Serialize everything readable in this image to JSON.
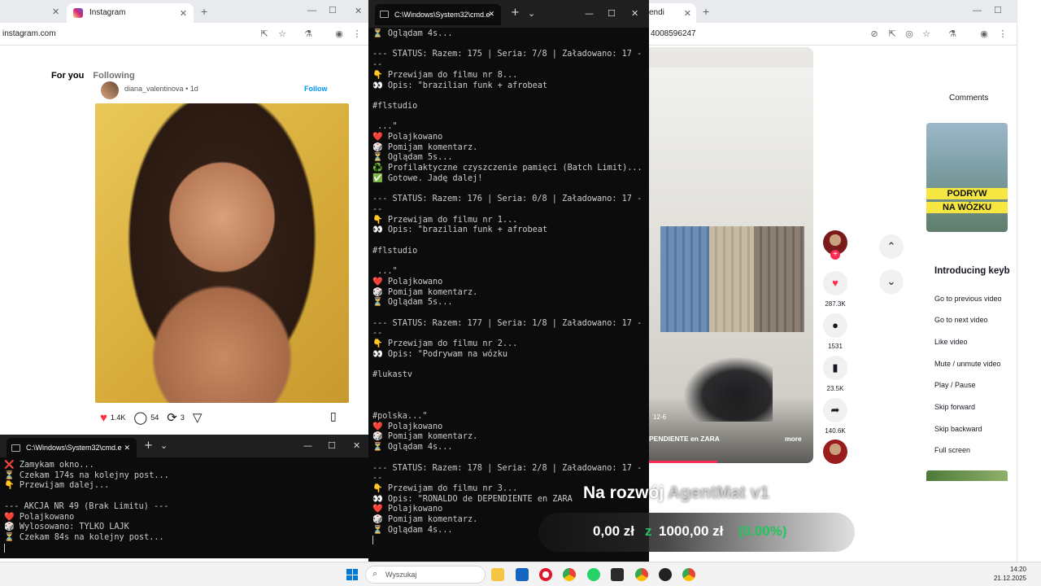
{
  "left_browser": {
    "tab_title": "Instagram",
    "url": "instagram.com",
    "feed_tabs": [
      "For you",
      "Following"
    ],
    "post": {
      "username": "diana_valentinova",
      "time": "1d",
      "follow_label": "Follow",
      "likes": "1.4K",
      "comments": "54",
      "reposts": "3"
    }
  },
  "terminal_main": {
    "title": "C:\\Windows\\System32\\cmd.e",
    "lines": [
      "⏳ Oglądam 4s...",
      "",
      "--- STATUS: Razem: 175 | Seria: 7/8 | Załadowano: 17 -",
      "--",
      "👇 Przewijam do filmu nr 8...",
      "👀 Opis: \"brazilian funk + afrobeat",
      "",
      "#flstudio",
      "",
      " ...\"",
      "❤️ Polajkowano",
      "🎲 Pomijam komentarz.",
      "⏳ Oglądam 5s...",
      "♻️ Profilaktyczne czyszczenie pamięci (Batch Limit)...",
      "✅ Gotowe. Jadę dalej!",
      "",
      "--- STATUS: Razem: 176 | Seria: 0/8 | Załadowano: 17 -",
      "--",
      "👇 Przewijam do filmu nr 1...",
      "👀 Opis: \"brazilian funk + afrobeat",
      "",
      "#flstudio",
      "",
      " ...\"",
      "❤️ Polajkowano",
      "🎲 Pomijam komentarz.",
      "⏳ Oglądam 5s...",
      "",
      "--- STATUS: Razem: 177 | Seria: 1/8 | Załadowano: 17 -",
      "--",
      "👇 Przewijam do filmu nr 2...",
      "👀 Opis: \"Podrywam na wózku",
      "",
      "#lukastv",
      "",
      "",
      "",
      "#polska...\"",
      "❤️ Polajkowano",
      "🎲 Pomijam komentarz.",
      "⏳ Oglądam 4s...",
      "",
      "--- STATUS: Razem: 178 | Seria: 2/8 | Załadowano: 17 -",
      "--",
      "👇 Przewijam do filmu nr 3...",
      "👀 Opis: \"RONALDO de DEPENDIENTE en ZARA",
      "❤️ Polajkowano",
      "🎲 Pomijam komentarz.",
      "⏳ Oglądam 4s..."
    ]
  },
  "terminal_small": {
    "title": "C:\\Windows\\System32\\cmd.e",
    "lines": [
      "❌ Zamykam okno...",
      "⏳ Czekam 174s na kolejny post...",
      "👇 Przewijam dalej...",
      "",
      "--- AKCJA NR 49 (Brak Limitu) ---",
      "❤️ Polajkowano",
      "🎲 Wylosowano: TYLKO LAJK",
      "⏳ Czekam 84s na kolejny post..."
    ]
  },
  "right_browser": {
    "tab_title": "endi",
    "url_fragment": "4008596247",
    "video": {
      "caption": "PENDIENTE en ZARA",
      "more_label": "more",
      "timestamp": "12-6"
    },
    "likes": "287.3K",
    "comments": "1531",
    "saves": "23.5K",
    "shares": "140.6K",
    "comments_tab": "Comments",
    "thumb_text_1": "PODRYW",
    "thumb_text_2": "NA WÓZKU",
    "keyboard_title": "Introducing keyb",
    "keyboard_items": [
      "Go to previous video",
      "Go to next video",
      "Like video",
      "Mute / unmute video",
      "Play / Pause",
      "Skip forward",
      "Skip backward",
      "Full screen"
    ]
  },
  "overlay": {
    "title": "Na rozwój",
    "title_dim": "AgentMat v1",
    "amount_current": "0,00 zł",
    "amount_separator": "z",
    "amount_goal": "1000,00 zł",
    "percent": "(0.00%)"
  },
  "taskbar": {
    "search_placeholder": "Wyszukaj",
    "time": "14:20",
    "date": "21.12.2025"
  },
  "colors": {
    "terminal_bg": "#0c0c0c",
    "tiktok_red": "#fe2c55",
    "overlay_green": "#22c55e"
  }
}
